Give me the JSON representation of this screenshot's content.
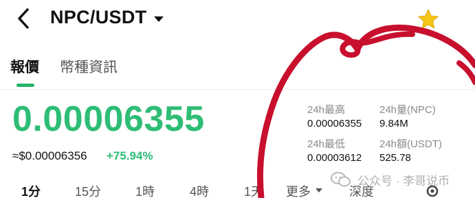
{
  "header": {
    "pair": "NPC/USDT",
    "icons": {
      "back": "back-arrow-icon",
      "dropdown": "caret-down-icon",
      "favorite": "star-icon"
    },
    "star_color": "#f5c518"
  },
  "tabs": [
    {
      "label": "報價",
      "active": true
    },
    {
      "label": "幣種資訊",
      "active": false
    }
  ],
  "ticker": {
    "price": "0.00006355",
    "fiat_price": "≈$0.00006356",
    "change_pct": "+75.94%",
    "up_color": "#2ebd75"
  },
  "stats": {
    "high_label": "24h最高",
    "high_value": "0.00006355",
    "vol_base_label": "24h量(NPC)",
    "vol_base_value": "9.84M",
    "low_label": "24h最低",
    "low_value": "0.00003612",
    "vol_quote_label": "24h額(USDT)",
    "vol_quote_value": "525.78"
  },
  "intervals": {
    "items": [
      "1分",
      "15分",
      "1時",
      "4時",
      "1天"
    ],
    "more": "更多",
    "depth": "深度"
  },
  "watermark": {
    "text": "公众号 · 李哥说币"
  },
  "annotation": {
    "color": "#c8102e"
  }
}
